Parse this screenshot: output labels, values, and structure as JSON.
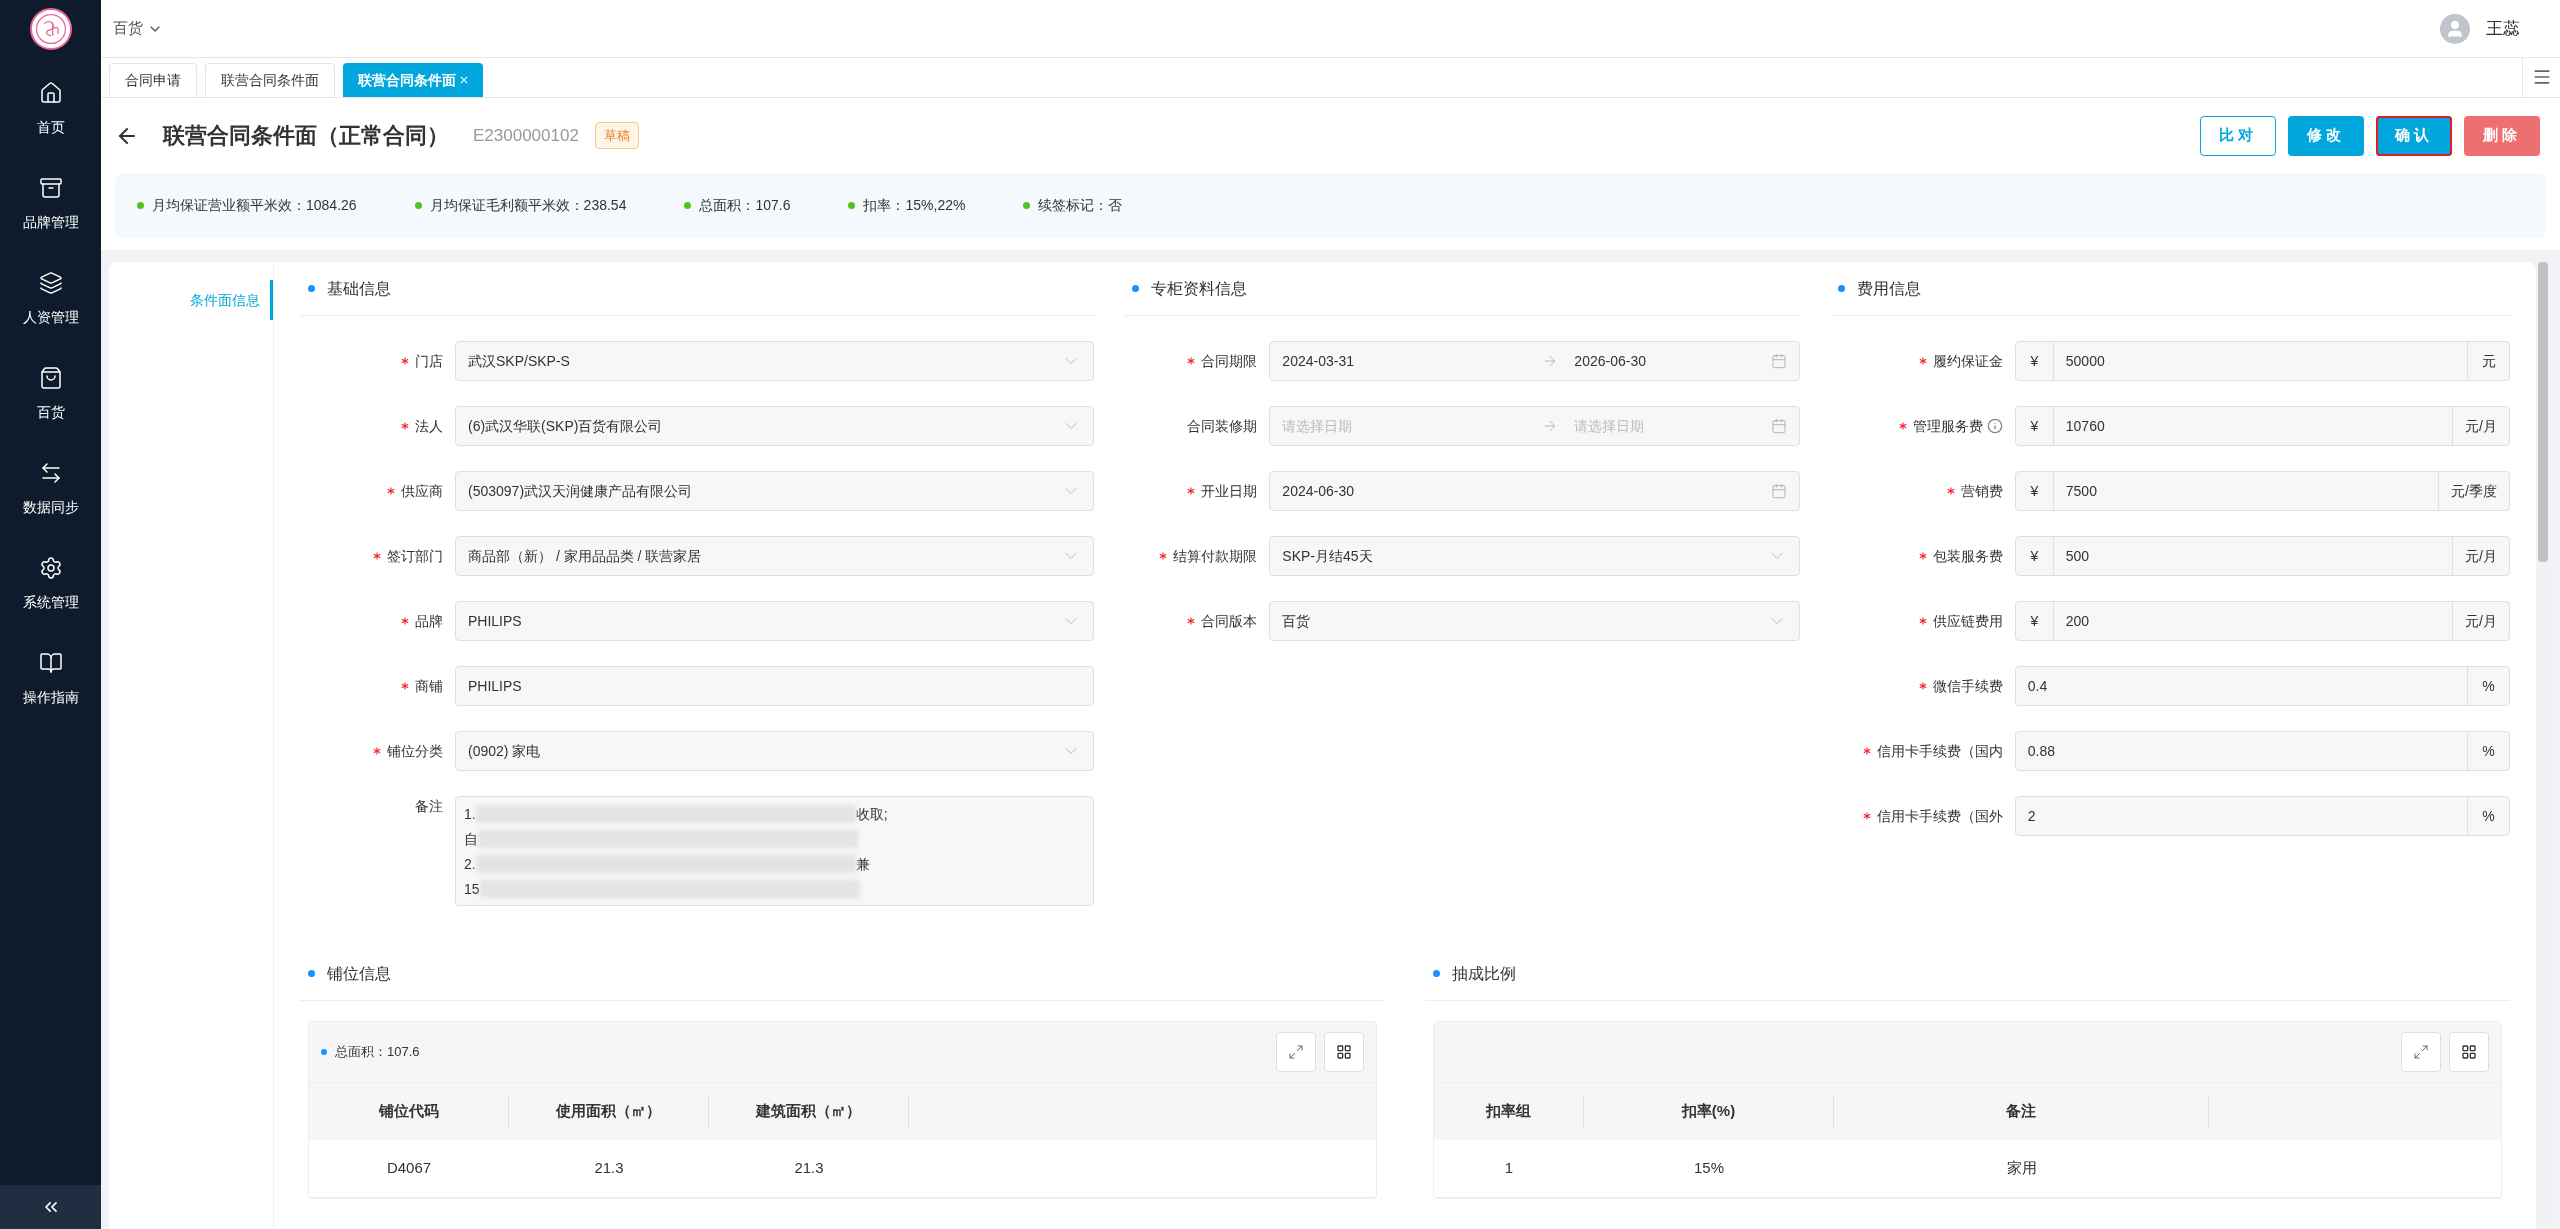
{
  "sidebar": {
    "items": [
      {
        "label": "首页"
      },
      {
        "label": "品牌管理"
      },
      {
        "label": "人资管理"
      },
      {
        "label": "百货"
      },
      {
        "label": "数据同步"
      },
      {
        "label": "系统管理"
      },
      {
        "label": "操作指南"
      }
    ]
  },
  "top_bar": {
    "store": "百货",
    "user": "王蕊"
  },
  "tabs": [
    {
      "label": "合同申请",
      "selected": false,
      "closable": false
    },
    {
      "label": "联营合同条件面",
      "selected": false,
      "closable": false
    },
    {
      "label": "联营合同条件面",
      "selected": true,
      "closable": true
    }
  ],
  "header": {
    "title": "联营合同条件面（正常合同）",
    "code": "E2300000102",
    "status": "草稿"
  },
  "buttons": [
    {
      "label": "比对",
      "kind": "outline",
      "highlighted": false
    },
    {
      "label": "修改",
      "kind": "primary",
      "highlighted": false
    },
    {
      "label": "确认",
      "kind": "primary",
      "highlighted": true
    },
    {
      "label": "删除",
      "kind": "danger",
      "highlighted": false
    }
  ],
  "summary": [
    "月均保证营业额平米效：1084.26",
    "月均保证毛利额平米效：238.54",
    "总面积：107.6",
    "扣率：15%,22%",
    "续签标记：否"
  ],
  "side_nav": [
    {
      "label": "条件面信息",
      "selected": true
    }
  ],
  "sections": [
    {
      "title": "基础信息",
      "fields": [
        {
          "label": "门店",
          "required": true,
          "kind": "select",
          "value": "武汉SKP/SKP-S"
        },
        {
          "label": "法人",
          "required": true,
          "kind": "select",
          "value": "(6)武汉华联(SKP)百货有限公司"
        },
        {
          "label": "供应商",
          "required": true,
          "kind": "select",
          "value": "(503097)武汉天润健康产品有限公司"
        },
        {
          "label": "签订部门",
          "required": true,
          "kind": "select",
          "value": "商品部（新） / 家用品品类 / 联营家居"
        },
        {
          "label": "品牌",
          "required": true,
          "kind": "select",
          "value": "PHILIPS"
        },
        {
          "label": "商铺",
          "required": true,
          "kind": "input",
          "value": "PHILIPS"
        },
        {
          "label": "铺位分类",
          "required": true,
          "kind": "select",
          "value": "(0902) 家电"
        },
        {
          "label": "备注",
          "required": false,
          "kind": "textarea",
          "lines": [
            {
              "start": "1.",
              "end": "收取;"
            },
            {
              "start": "自"
            },
            {
              "start": "2.",
              "end": "兼"
            },
            {
              "start": "15"
            }
          ]
        }
      ]
    },
    {
      "title": "专柜资料信息",
      "fields": [
        {
          "label": "合同期限",
          "required": true,
          "kind": "daterange",
          "start": "2024-03-31",
          "end": "2026-06-30"
        },
        {
          "label": "合同装修期",
          "required": false,
          "kind": "daterange",
          "start_placeholder": "请选择日期",
          "end_placeholder": "请选择日期"
        },
        {
          "label": "开业日期",
          "required": true,
          "kind": "date",
          "value": "2024-06-30"
        },
        {
          "label": "结算付款期限",
          "required": true,
          "kind": "select",
          "value": "SKP-月结45天"
        },
        {
          "label": "合同版本",
          "required": true,
          "kind": "select",
          "value": "百货"
        }
      ]
    },
    {
      "title": "费用信息",
      "fields": [
        {
          "label": "履约保证金",
          "required": true,
          "kind": "addon",
          "prefix": "¥",
          "value": "50000",
          "suffix": "元",
          "info": false
        },
        {
          "label": "管理服务费",
          "required": true,
          "kind": "addon",
          "prefix": "¥",
          "value": "10760",
          "suffix": "元/月",
          "info": true
        },
        {
          "label": "营销费",
          "required": true,
          "kind": "addon",
          "prefix": "¥",
          "value": "7500",
          "suffix": "元/季度",
          "info": false
        },
        {
          "label": "包装服务费",
          "required": true,
          "kind": "addon",
          "prefix": "¥",
          "value": "500",
          "suffix": "元/月",
          "info": false
        },
        {
          "label": "供应链费用",
          "required": true,
          "kind": "addon",
          "prefix": "¥",
          "value": "200",
          "suffix": "元/月",
          "info": false
        },
        {
          "label": "微信手续费",
          "required": true,
          "kind": "addon",
          "value": "0.4",
          "suffix": "%",
          "info": false
        },
        {
          "label": "信用卡手续费（国内",
          "required": true,
          "kind": "addon",
          "value": "0.88",
          "suffix": "%",
          "info": false
        },
        {
          "label": "信用卡手续费（国外",
          "required": true,
          "kind": "addon",
          "value": "2",
          "suffix": "%",
          "info": false
        }
      ]
    }
  ],
  "tables": [
    {
      "title": "铺位信息",
      "note": "总面积：107.6",
      "columns": [
        "铺位代码",
        "使用面积（㎡）",
        "建筑面积（㎡）"
      ],
      "rows": [
        [
          "D4067",
          "21.3",
          "21.3"
        ]
      ]
    },
    {
      "title": "抽成比例",
      "columns": [
        "扣率组",
        "扣率(%)",
        "备注"
      ],
      "rows": [
        [
          "1",
          "15%",
          "家用"
        ]
      ]
    }
  ]
}
